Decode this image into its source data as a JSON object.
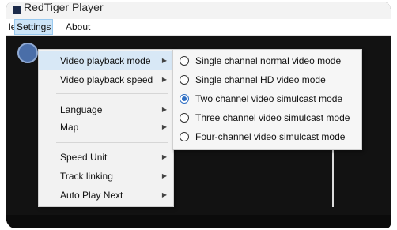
{
  "titlebar": {
    "title": "RedTiger Player"
  },
  "menubar": {
    "file_label": "le",
    "settings_label": "Settings",
    "about_label": "About"
  },
  "settings_menu": {
    "items": [
      {
        "label": "Video playback mode",
        "has_submenu": true
      },
      {
        "label": "Video playback speed",
        "has_submenu": true
      },
      {
        "label": "Language",
        "has_submenu": true
      },
      {
        "label": "Map",
        "has_submenu": true
      },
      {
        "label": "Speed Unit",
        "has_submenu": true
      },
      {
        "label": "Track linking",
        "has_submenu": true
      },
      {
        "label": "Auto Play Next",
        "has_submenu": true
      }
    ]
  },
  "playback_mode_submenu": {
    "options": [
      {
        "label": "Single channel normal video mode",
        "selected": false
      },
      {
        "label": "Single channel HD video mode",
        "selected": false
      },
      {
        "label": "Two channel video simulcast mode",
        "selected": true
      },
      {
        "label": "Three channel video simulcast mode",
        "selected": false
      },
      {
        "label": "Four-channel video simulcast mode",
        "selected": false
      }
    ]
  },
  "colors": {
    "menu_highlight": "#cce4f7",
    "radio_selected": "#2f6fc4",
    "background": "#121212"
  }
}
